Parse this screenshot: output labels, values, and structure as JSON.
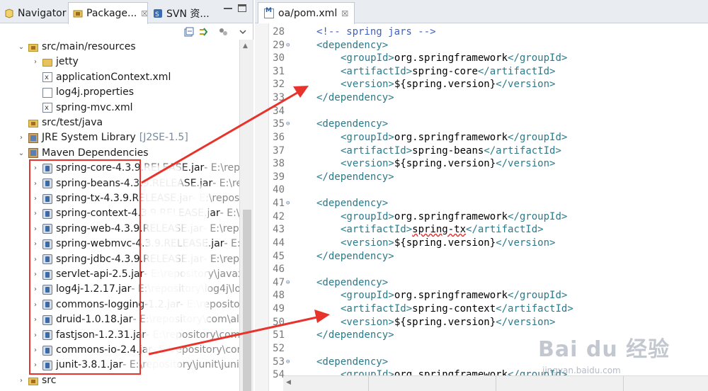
{
  "tabs": [
    {
      "label": "Navigator",
      "icon": "navigator-icon",
      "active": false
    },
    {
      "label": "Package...",
      "icon": "package-explorer-icon",
      "active": true,
      "close": "☒"
    },
    {
      "label": "SVN 资...",
      "icon": "svn-icon",
      "active": false
    }
  ],
  "tree": [
    {
      "twisty": "⌄",
      "icon": "pkgfolder",
      "label": "src/main/resources",
      "suffix": ""
    },
    {
      "twisty": "›",
      "icon": "folder",
      "label": "jetty",
      "suffix": ""
    },
    {
      "twisty": "",
      "icon": "xml",
      "label": "applicationContext.xml",
      "suffix": ""
    },
    {
      "twisty": "",
      "icon": "file",
      "label": "log4j.properties",
      "suffix": ""
    },
    {
      "twisty": "",
      "icon": "xml",
      "label": "spring-mvc.xml",
      "suffix": ""
    },
    {
      "twisty": "",
      "icon": "pkgfolder",
      "label": "src/test/java",
      "suffix": ""
    },
    {
      "twisty": "›",
      "icon": "lib",
      "label": "JRE System Library",
      "suffix": "[J2SE-1.5]"
    },
    {
      "twisty": "⌄",
      "icon": "lib",
      "label": "Maven Dependencies",
      "suffix": ""
    },
    {
      "twisty": "›",
      "icon": "jar",
      "label": "spring-core-4.3.9.RELEASE.jar",
      "suffix": " - E:\\repo"
    },
    {
      "twisty": "›",
      "icon": "jar",
      "label": "spring-beans-4.3.9.RELEASE.jar",
      "suffix": " - E:\\rep"
    },
    {
      "twisty": "›",
      "icon": "jar",
      "label": "spring-tx-4.3.9.RELEASE.jar",
      "suffix": " - E:\\reposit"
    },
    {
      "twisty": "›",
      "icon": "jar",
      "label": "spring-context-4.3.9.RELEASE.jar",
      "suffix": " - E:\\re"
    },
    {
      "twisty": "›",
      "icon": "jar",
      "label": "spring-web-4.3.9.RELEASE.jar",
      "suffix": " - E:\\repo"
    },
    {
      "twisty": "›",
      "icon": "jar",
      "label": "spring-webmvc-4.3.9.RELEASE.jar",
      "suffix": " - E:\\r"
    },
    {
      "twisty": "›",
      "icon": "jar",
      "label": "spring-jdbc-4.3.9.RELEASE.jar",
      "suffix": " - E:\\repo"
    },
    {
      "twisty": "›",
      "icon": "jar",
      "label": "servlet-api-2.5.jar",
      "suffix": " - E:\\repository\\javax"
    },
    {
      "twisty": "›",
      "icon": "jar",
      "label": "log4j-1.2.17.jar",
      "suffix": " - E:\\repository\\log4j\\lo"
    },
    {
      "twisty": "›",
      "icon": "jar",
      "label": "commons-logging-1.2.jar",
      "suffix": " - E:\\reposito"
    },
    {
      "twisty": "›",
      "icon": "jar",
      "label": "druid-1.0.18.jar",
      "suffix": " - E:\\repository\\com\\ali"
    },
    {
      "twisty": "›",
      "icon": "jar",
      "label": "fastjson-1.2.31.jar",
      "suffix": " - E:\\repository\\com"
    },
    {
      "twisty": "›",
      "icon": "jar",
      "label": "commons-io-2.4.jar",
      "suffix": " - E:\\repository\\com"
    },
    {
      "twisty": "›",
      "icon": "jar",
      "label": "junit-3.8.1.jar",
      "suffix": " - E:\\repository\\junit\\junit"
    },
    {
      "twisty": "›",
      "icon": "pkgfolder",
      "label": "src",
      "suffix": ""
    }
  ],
  "editor": {
    "tab_label": "oa/pom.xml",
    "tab_close": "☒",
    "lines": [
      {
        "n": "28",
        "fold": "",
        "indent": 0,
        "parts": [
          [
            "cmt",
            "<!-- spring jars -->"
          ]
        ]
      },
      {
        "n": "29",
        "fold": "⊖",
        "indent": 0,
        "parts": [
          [
            "tag",
            "<dependency>"
          ]
        ]
      },
      {
        "n": "30",
        "fold": "",
        "indent": 1,
        "parts": [
          [
            "tag",
            "<groupId>"
          ],
          [
            "val",
            "org.springframework"
          ],
          [
            "tag",
            "</groupId>"
          ]
        ]
      },
      {
        "n": "31",
        "fold": "",
        "indent": 1,
        "parts": [
          [
            "tag",
            "<artifactId>"
          ],
          [
            "val",
            "spring-core"
          ],
          [
            "tag",
            "</artifactId>"
          ]
        ]
      },
      {
        "n": "32",
        "fold": "",
        "indent": 1,
        "parts": [
          [
            "tag",
            "<version>"
          ],
          [
            "val",
            "${spring.version}"
          ],
          [
            "tag",
            "</version>"
          ]
        ]
      },
      {
        "n": "33",
        "fold": "",
        "indent": 0,
        "parts": [
          [
            "tag",
            "</dependency>"
          ]
        ]
      },
      {
        "n": "34",
        "fold": "",
        "indent": 0,
        "parts": []
      },
      {
        "n": "35",
        "fold": "⊖",
        "indent": 0,
        "parts": [
          [
            "tag",
            "<dependency>"
          ]
        ]
      },
      {
        "n": "36",
        "fold": "",
        "indent": 1,
        "parts": [
          [
            "tag",
            "<groupId>"
          ],
          [
            "val",
            "org.springframework"
          ],
          [
            "tag",
            "</groupId>"
          ]
        ]
      },
      {
        "n": "37",
        "fold": "",
        "indent": 1,
        "parts": [
          [
            "tag",
            "<artifactId>"
          ],
          [
            "val",
            "spring-beans"
          ],
          [
            "tag",
            "</artifactId>"
          ]
        ]
      },
      {
        "n": "38",
        "fold": "",
        "indent": 1,
        "parts": [
          [
            "tag",
            "<version>"
          ],
          [
            "val",
            "${spring.version}"
          ],
          [
            "tag",
            "</version>"
          ]
        ]
      },
      {
        "n": "39",
        "fold": "",
        "indent": 0,
        "parts": [
          [
            "tag",
            "</dependency>"
          ]
        ]
      },
      {
        "n": "40",
        "fold": "",
        "indent": 0,
        "parts": []
      },
      {
        "n": "41",
        "fold": "⊖",
        "indent": 0,
        "parts": [
          [
            "tag",
            "<dependency>"
          ]
        ]
      },
      {
        "n": "42",
        "fold": "",
        "indent": 1,
        "parts": [
          [
            "tag",
            "<groupId>"
          ],
          [
            "val",
            "org.springframework"
          ],
          [
            "tag",
            "</groupId>"
          ]
        ]
      },
      {
        "n": "43",
        "fold": "",
        "indent": 1,
        "parts": [
          [
            "tag",
            "<artifactId>"
          ],
          [
            "err",
            "spring-tx"
          ],
          [
            "tag",
            "</artifactId>"
          ]
        ]
      },
      {
        "n": "44",
        "fold": "",
        "indent": 1,
        "parts": [
          [
            "tag",
            "<version>"
          ],
          [
            "val",
            "${spring.version}"
          ],
          [
            "tag",
            "</version>"
          ]
        ]
      },
      {
        "n": "45",
        "fold": "",
        "indent": 0,
        "parts": [
          [
            "tag",
            "</dependency>"
          ]
        ]
      },
      {
        "n": "46",
        "fold": "",
        "indent": 0,
        "parts": []
      },
      {
        "n": "47",
        "fold": "⊖",
        "indent": 0,
        "parts": [
          [
            "tag",
            "<dependency>"
          ]
        ]
      },
      {
        "n": "48",
        "fold": "",
        "indent": 1,
        "parts": [
          [
            "tag",
            "<groupId>"
          ],
          [
            "val",
            "org.springframework"
          ],
          [
            "tag",
            "</groupId>"
          ]
        ]
      },
      {
        "n": "49",
        "fold": "",
        "indent": 1,
        "parts": [
          [
            "tag",
            "<artifactId>"
          ],
          [
            "val",
            "spring-context"
          ],
          [
            "tag",
            "</artifactId>"
          ]
        ]
      },
      {
        "n": "50",
        "fold": "",
        "indent": 1,
        "parts": [
          [
            "tag",
            "<version>"
          ],
          [
            "val",
            "${spring.version}"
          ],
          [
            "tag",
            "</version>"
          ]
        ]
      },
      {
        "n": "51",
        "fold": "",
        "indent": 0,
        "parts": [
          [
            "tag",
            "</dependency>"
          ]
        ]
      },
      {
        "n": "52",
        "fold": "",
        "indent": 0,
        "parts": []
      },
      {
        "n": "53",
        "fold": "⊖",
        "indent": 0,
        "parts": [
          [
            "tag",
            "<dependency>"
          ]
        ]
      },
      {
        "n": "54",
        "fold": "",
        "indent": 1,
        "parts": [
          [
            "tag",
            "<groupId>"
          ],
          [
            "val",
            "org.springframework"
          ],
          [
            "tag",
            "</groupId>"
          ]
        ]
      }
    ]
  },
  "watermark": {
    "brand": "Bai du 经验",
    "url": "jingyan.baidu.com"
  },
  "colors": {
    "annotation_red": "#e8332c",
    "xml_tag": "#2b7a8a",
    "xml_comment": "#3f5fbf"
  }
}
